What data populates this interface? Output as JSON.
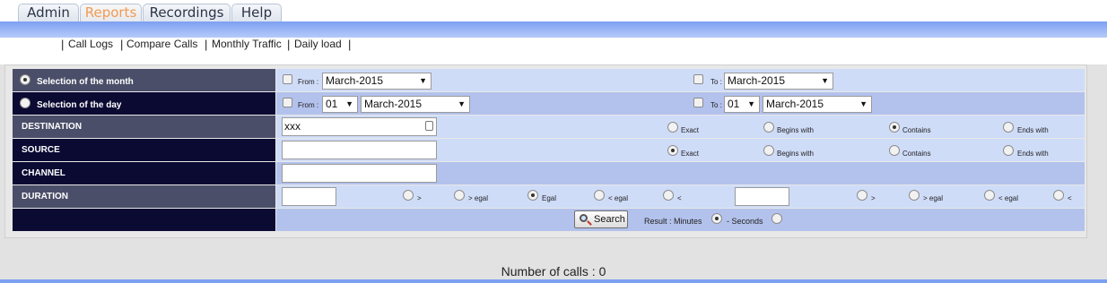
{
  "tabs": [
    {
      "label": "Admin"
    },
    {
      "label": "Reports"
    },
    {
      "label": "Recordings"
    },
    {
      "label": "Help"
    }
  ],
  "subnav": [
    "Call Logs",
    "Compare Calls",
    "Monthly Traffic",
    "Daily load"
  ],
  "colors": {
    "accent_tab": "#f29a52",
    "band": "#7ca0f2",
    "label_dark": "#0a0a33",
    "label_slate": "#4a4e68",
    "row_light": "#cfdcf8",
    "row_mid": "#b3c2ec"
  },
  "filters": {
    "month": {
      "label": "Selection of the month",
      "from_label": "From :",
      "from_month": "March-2015",
      "to_label": "To :",
      "to_month": "March-2015"
    },
    "day": {
      "label": "Selection of the day",
      "from_label": "From :",
      "from_day": "01",
      "from_month": "March-2015",
      "to_label": "To :",
      "to_day": "01",
      "to_month": "March-2015"
    },
    "destination": {
      "label": "DESTINATION",
      "value": "xxx"
    },
    "source": {
      "label": "SOURCE",
      "value": ""
    },
    "channel": {
      "label": "CHANNEL",
      "value": ""
    },
    "duration": {
      "label": "DURATION",
      "value1": "",
      "value2": ""
    },
    "match_options": [
      "Exact",
      "Begins with",
      "Contains",
      "Ends with"
    ],
    "destination_match": "Contains",
    "source_match": "Exact",
    "duration_ops": [
      ">",
      "> egal",
      "Egal",
      "< egal",
      "<"
    ],
    "duration_selected_1": "Egal"
  },
  "search": {
    "button": "Search",
    "result_label": "Result : Minutes",
    "seconds_label": "- Seconds",
    "unit_selected": "Minutes"
  },
  "footer": {
    "calls": "Number of calls : 0"
  }
}
